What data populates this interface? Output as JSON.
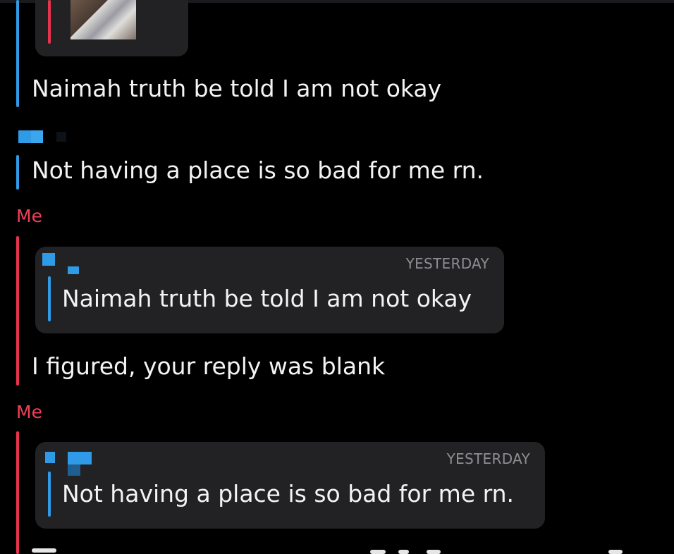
{
  "messages": [
    {
      "text": "Naimah truth be told I am not okay"
    },
    {
      "text": "Not having a place is so bad for me rn."
    },
    {
      "sender": "Me",
      "quoted_timestamp": "YESTERDAY",
      "quoted_text": "Naimah truth be told I am not okay",
      "text": "I figured, your reply was blank"
    },
    {
      "sender": "Me",
      "quoted_timestamp": "YESTERDAY",
      "quoted_text": "Not having a place is so bad for me rn."
    }
  ],
  "colors": {
    "background": "#000000",
    "received_accent": "#2f9ae6",
    "sent_accent": "#e8334e",
    "card": "#222224"
  }
}
